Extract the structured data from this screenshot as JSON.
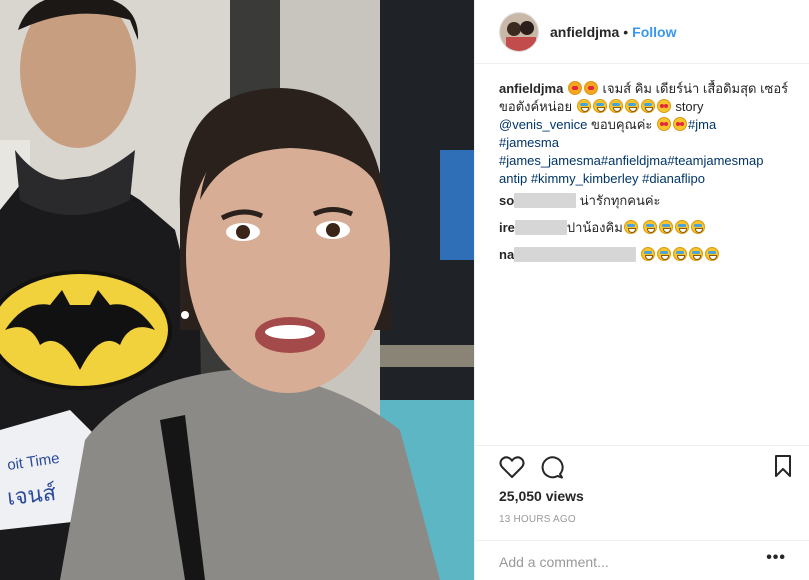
{
  "post": {
    "username": "anfieldjma",
    "dot": "•",
    "follow_label": "Follow"
  },
  "caption": {
    "username": "anfieldjma",
    "text_1": "เจมส์ คิม เดียร์น่า เสื้อดิมสุด",
    "text_2": "เซอร์ ขอตังค์หน่อย",
    "text_3": "story",
    "mention": "@venis_venice",
    "text_4": "ขอบคุณค่ะ",
    "tags_line1": "#jma",
    "tags_line2": "#jamesma",
    "tags_line3": "#james_jamesma#anfieldjma#teamjamesmap",
    "tags_line4a": "antip",
    "tags_line4b": "#kimmy_kimberley",
    "tags_line4c": "#dianaflipo"
  },
  "comments": [
    {
      "user_prefix": "so",
      "text": "น่ารักทุกคนค่ะ"
    },
    {
      "user_prefix": "ire",
      "text": "ปาน้องคิม"
    },
    {
      "user_prefix": "na",
      "text": ""
    }
  ],
  "icons": {
    "like": "heart-outline-icon",
    "comment": "speech-bubble-icon",
    "save": "bookmark-icon",
    "more": "ellipsis-icon"
  },
  "stats": {
    "views": "25,050 views",
    "time": "13 HOURS AGO"
  },
  "comment_box": {
    "placeholder": "Add a comment...",
    "more_label": "•••"
  },
  "colors": {
    "link": "#3897f0",
    "hashtag": "#003569",
    "muted": "#999999",
    "text": "#262626"
  }
}
